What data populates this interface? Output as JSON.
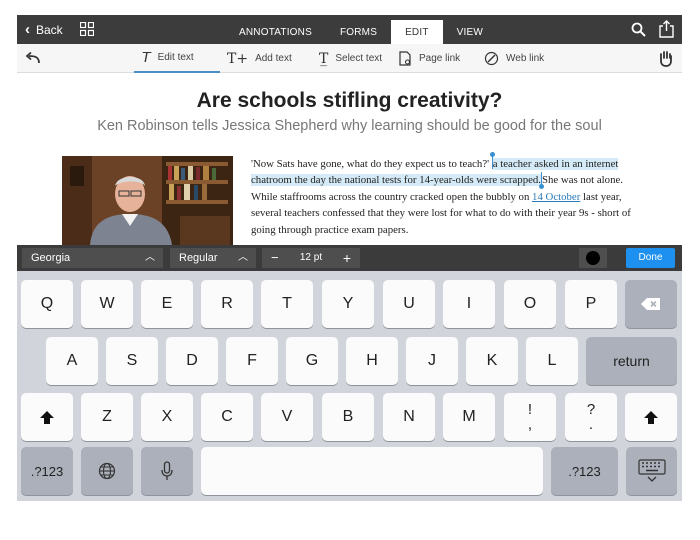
{
  "topbar": {
    "back_label": "Back",
    "tabs": [
      "ANNOTATIONS",
      "FORMS",
      "EDIT",
      "VIEW"
    ],
    "active_tab": "EDIT"
  },
  "toolbar": {
    "tools": [
      {
        "label": "Edit text",
        "glyph": "T"
      },
      {
        "label": "Add text",
        "glyph": "T+"
      },
      {
        "label": "Select text",
        "glyph": "T"
      },
      {
        "label": "Page link",
        "glyph": "▭"
      },
      {
        "label": "Web link",
        "glyph": "⌀"
      }
    ],
    "active_tool": "Edit text"
  },
  "document": {
    "headline": "Are schools stifling creativity?",
    "subhead": "Ken Robinson tells Jessica Shepherd why learning should be good for the soul",
    "body": {
      "part1": "'Now Sats have gone, what do they expect us to teach?'",
      "highlighted": "a teacher asked in an internet chatroom the day the national tests for 14-year-olds were scrapped.",
      "part2": "She was not alone. While staffrooms across the country cracked open the bubbly on ",
      "link": "14 October",
      "part3": " last year, several teachers confessed that they were lost for what to do with their year 9s - short of going through practice exam papers."
    }
  },
  "formatbar": {
    "font": "Georgia",
    "style": "Regular",
    "size": "12 pt",
    "color": "#000000",
    "done_label": "Done"
  },
  "keyboard": {
    "row1": [
      "Q",
      "W",
      "E",
      "R",
      "T",
      "Y",
      "U",
      "I",
      "O",
      "P"
    ],
    "row2": [
      "A",
      "S",
      "D",
      "F",
      "G",
      "H",
      "J",
      "K",
      "L"
    ],
    "row3": [
      "Z",
      "X",
      "C",
      "V",
      "B",
      "N",
      "M"
    ],
    "return_label": "return",
    "numbers_label": ".?123",
    "punct": [
      {
        "top": "!",
        "bottom": ","
      },
      {
        "top": "?",
        "bottom": "."
      }
    ]
  },
  "colors": {
    "topbar": "#3c3c3c",
    "highlight": "#d4eaf6",
    "link": "#2a7ab8",
    "done": "#1e90f0",
    "keyboard": "#d1d4da"
  }
}
